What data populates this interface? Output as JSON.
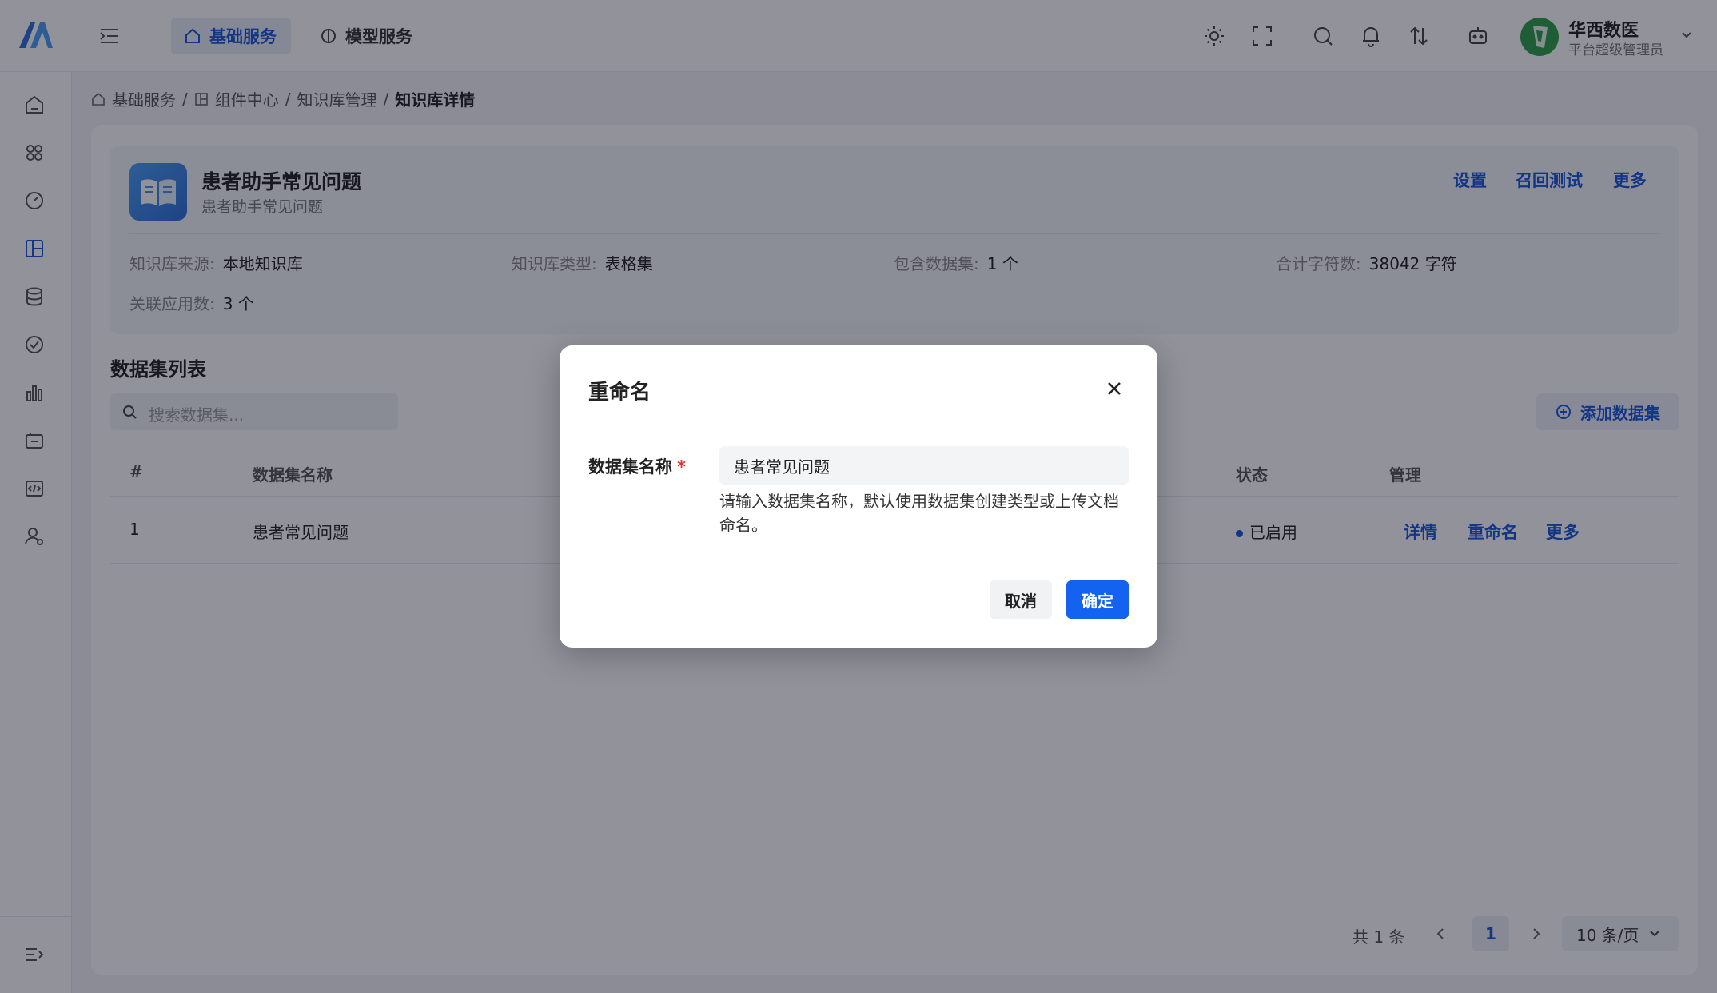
{
  "topnav": {
    "tabs": [
      {
        "label": "基础服务",
        "active": true
      },
      {
        "label": "模型服务",
        "active": false
      }
    ],
    "user": {
      "name": "华西数医",
      "role": "平台超级管理员"
    }
  },
  "breadcrumb": [
    "基础服务",
    "组件中心",
    "知识库管理",
    "知识库详情"
  ],
  "knowledge_base": {
    "title": "患者助手常见问题",
    "subtitle": "患者助手常见问题",
    "actions": [
      "设置",
      "召回测试",
      "更多"
    ],
    "meta": [
      {
        "label": "知识库来源:",
        "value": "本地知识库"
      },
      {
        "label": "知识库类型:",
        "value": "表格集"
      },
      {
        "label": "包含数据集:",
        "value": "1 个"
      },
      {
        "label": "合计字符数:",
        "value": "38042 字符"
      },
      {
        "label": "关联应用数:",
        "value": "3 个"
      }
    ]
  },
  "dataset_list": {
    "title": "数据集列表",
    "search_placeholder": "搜索数据集...",
    "add_label": "添加数据集",
    "columns": [
      "#",
      "数据集名称",
      "状态",
      "管理"
    ],
    "rows": [
      {
        "index": "1",
        "name": "患者常见问题",
        "status": "已启用",
        "actions": [
          "详情",
          "重命名",
          "更多"
        ]
      }
    ]
  },
  "pagination": {
    "total": "共 1 条",
    "current": "1",
    "page_size": "10 条/页"
  },
  "modal": {
    "title": "重命名",
    "field_label": "数据集名称",
    "required_mark": "*",
    "field_value": "患者常见问题",
    "help": "请输入数据集名称，默认使用数据集创建类型或上传文档命名。",
    "cancel": "取消",
    "confirm": "确定"
  },
  "colors": {
    "primary": "#1a56db",
    "confirm": "#1463f0",
    "avatar": "#2e9e4a"
  }
}
